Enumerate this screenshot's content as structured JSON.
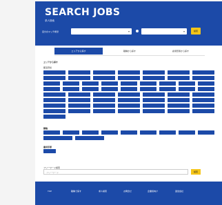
{
  "hero": {
    "title": "SEARCH JOBS",
    "subtitle": "求人検索",
    "label": "自分のマッチ希望",
    "input1_placeholder": "",
    "input2_placeholder": "",
    "search_button": "検索"
  },
  "tabs": [
    {
      "label": "エリアから探す"
    },
    {
      "label": "職種から探す"
    },
    {
      "label": "雇用形態から探す"
    }
  ],
  "area_section": {
    "heading": "エリアから探す",
    "sub": "都道府県"
  },
  "job_section": {
    "heading": "職種"
  },
  "employment_section": {
    "heading": "雇用形態"
  },
  "free_search": {
    "label": "フリーワード検索",
    "placeholder": "フリーワード",
    "button": "検索"
  },
  "footer": {
    "links": [
      "TOP",
      "職種で探す",
      "求人検索",
      "お問合せ",
      "企業様向け",
      "運営会社"
    ]
  },
  "colors": {
    "brand": "#1c4aa8",
    "accent": "#f5c518"
  }
}
